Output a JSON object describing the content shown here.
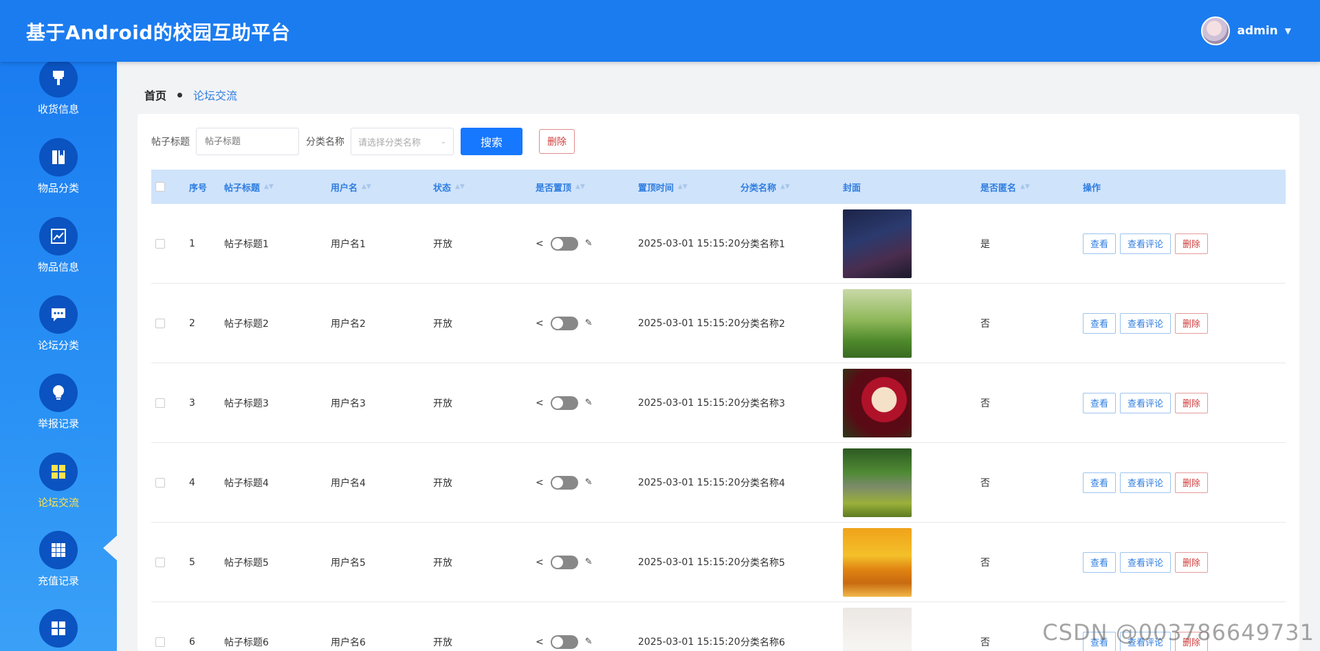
{
  "header": {
    "title": "基于Android的校园互助平台",
    "username": "admin"
  },
  "sidebar": {
    "items": [
      {
        "label": "收货信息",
        "icon": "brush-icon"
      },
      {
        "label": "物品分类",
        "icon": "book-icon"
      },
      {
        "label": "物品信息",
        "icon": "chart-line-icon"
      },
      {
        "label": "论坛分类",
        "icon": "chat-icon"
      },
      {
        "label": "举报记录",
        "icon": "bulb-icon"
      },
      {
        "label": "论坛交流",
        "icon": "grid-4-icon",
        "active": true
      },
      {
        "label": "充值记录",
        "icon": "grid-9-icon"
      },
      {
        "label": "",
        "icon": "grid-4-icon"
      }
    ]
  },
  "breadcrumb": {
    "home": "首页",
    "current": "论坛交流"
  },
  "search": {
    "title_label": "帖子标题",
    "title_placeholder": "帖子标题",
    "category_label": "分类名称",
    "category_placeholder": "请选择分类名称",
    "search_button": "搜索",
    "delete_button": "删除"
  },
  "table": {
    "headers": [
      "序号",
      "帖子标题",
      "用户名",
      "状态",
      "是否置顶",
      "置顶时间",
      "分类名称",
      "封面",
      "是否匿名",
      "操作"
    ],
    "actions": {
      "view": "查看",
      "view_comments": "查看评论",
      "delete": "删除"
    },
    "rows": [
      {
        "index": "1",
        "title": "帖子标题1",
        "user": "用户名1",
        "status": "开放",
        "pin_time": "2025-03-01 15:15:20",
        "category": "分类名称1",
        "anonymous": "是",
        "cover": "night-sky"
      },
      {
        "index": "2",
        "title": "帖子标题2",
        "user": "用户名2",
        "status": "开放",
        "pin_time": "2025-03-01 15:15:20",
        "category": "分类名称2",
        "anonymous": "否",
        "cover": "yoga-lawn"
      },
      {
        "index": "3",
        "title": "帖子标题3",
        "user": "用户名3",
        "status": "开放",
        "pin_time": "2025-03-01 15:15:20",
        "category": "分类名称3",
        "anonymous": "否",
        "cover": "berry-cake"
      },
      {
        "index": "4",
        "title": "帖子标题4",
        "user": "用户名4",
        "status": "开放",
        "pin_time": "2025-03-01 15:15:20",
        "category": "分类名称4",
        "anonymous": "否",
        "cover": "stone-bridge"
      },
      {
        "index": "5",
        "title": "帖子标题5",
        "user": "用户名5",
        "status": "开放",
        "pin_time": "2025-03-01 15:15:20",
        "category": "分类名称5",
        "anonymous": "否",
        "cover": "sunset-lake"
      },
      {
        "index": "6",
        "title": "帖子标题6",
        "user": "用户名6",
        "status": "开放",
        "pin_time": "2025-03-01 15:15:20",
        "category": "分类名称6",
        "anonymous": "否",
        "cover": "coffee-cup"
      }
    ]
  },
  "watermark": "CSDN @003786649731",
  "colors": {
    "header": "#1b7cf0",
    "sidebar_active": "#ffe34d",
    "primary_button": "#1677ff",
    "danger": "#d23c3c",
    "table_head": "#cfe3fb"
  }
}
